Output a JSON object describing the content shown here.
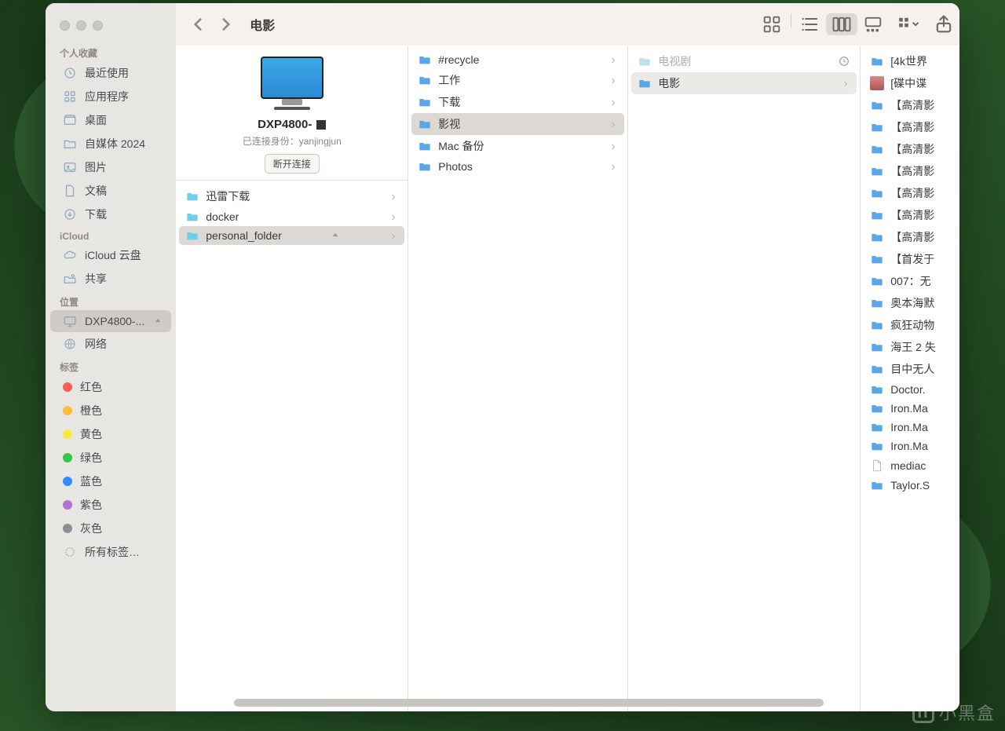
{
  "window": {
    "title": "电影"
  },
  "sidebar": {
    "sections": [
      {
        "header": "个人收藏",
        "items": [
          {
            "icon": "clock",
            "label": "最近使用"
          },
          {
            "icon": "grid",
            "label": "应用程序"
          },
          {
            "icon": "desktop",
            "label": "桌面"
          },
          {
            "icon": "folder",
            "label": "自媒体 2024"
          },
          {
            "icon": "image",
            "label": "图片"
          },
          {
            "icon": "doc",
            "label": "文稿"
          },
          {
            "icon": "download",
            "label": "下载"
          }
        ]
      },
      {
        "header": "iCloud",
        "items": [
          {
            "icon": "cloud",
            "label": "iCloud 云盘"
          },
          {
            "icon": "share",
            "label": "共享"
          }
        ]
      },
      {
        "header": "位置",
        "items": [
          {
            "icon": "display",
            "label": "DXP4800-...",
            "selected": true,
            "eject": true
          },
          {
            "icon": "globe",
            "label": "网络"
          }
        ]
      },
      {
        "header": "标签",
        "items": [
          {
            "tag": "#fc5b57",
            "label": "红色"
          },
          {
            "tag": "#fdbc40",
            "label": "橙色"
          },
          {
            "tag": "#fce83a",
            "label": "黄色"
          },
          {
            "tag": "#33c748",
            "label": "绿色"
          },
          {
            "tag": "#2e8cff",
            "label": "蓝色"
          },
          {
            "tag": "#b072da",
            "label": "紫色"
          },
          {
            "tag": "#8e8e93",
            "label": "灰色"
          },
          {
            "icon": "alltags",
            "label": "所有标签…"
          }
        ]
      }
    ]
  },
  "device": {
    "name": "DXP4800-",
    "status_prefix": "已连接身份：",
    "user": "yanjingjun",
    "disconnect": "断开连接"
  },
  "columns": [
    {
      "items": [
        {
          "label": "迅雷下载",
          "folder": "cyan",
          "chev": true
        },
        {
          "label": "docker",
          "folder": "cyan",
          "chev": true
        },
        {
          "label": "personal_folder",
          "folder": "cyan",
          "selected": true,
          "eject": true,
          "chev": true
        }
      ]
    },
    {
      "items": [
        {
          "label": "#recycle",
          "folder": "blue",
          "chev": true
        },
        {
          "label": "工作",
          "folder": "blue",
          "chev": true
        },
        {
          "label": "下载",
          "folder": "blue",
          "chev": true
        },
        {
          "label": "影视",
          "folder": "blue",
          "selected": true,
          "chev": true
        },
        {
          "label": "Mac 备份",
          "folder": "blue",
          "chev": true
        },
        {
          "label": "Photos",
          "folder": "blue",
          "chev": true
        }
      ]
    },
    {
      "items": [
        {
          "label": "电视剧",
          "folder": "light",
          "dim": true,
          "chev": false,
          "time": true
        },
        {
          "label": "电影",
          "folder": "blue",
          "selected": "light",
          "chev": true
        }
      ]
    },
    {
      "items": [
        {
          "label": "[4k世界",
          "folder": "blue"
        },
        {
          "label": "[碟中谍",
          "file": "img"
        },
        {
          "label": "【高清影",
          "folder": "blue"
        },
        {
          "label": "【高清影",
          "folder": "blue"
        },
        {
          "label": "【高清影",
          "folder": "blue"
        },
        {
          "label": "【高清影",
          "folder": "blue"
        },
        {
          "label": "【高清影",
          "folder": "blue"
        },
        {
          "label": "【高清影",
          "folder": "blue"
        },
        {
          "label": "【高清影",
          "folder": "blue"
        },
        {
          "label": "【首发于",
          "folder": "blue"
        },
        {
          "label": "007：无",
          "folder": "blue"
        },
        {
          "label": "奥本海默",
          "folder": "blue"
        },
        {
          "label": "疯狂动物",
          "folder": "blue"
        },
        {
          "label": "海王 2 失",
          "folder": "blue"
        },
        {
          "label": "目中无人",
          "folder": "blue"
        },
        {
          "label": "Doctor.",
          "folder": "blue"
        },
        {
          "label": "Iron.Ma",
          "folder": "blue"
        },
        {
          "label": "Iron.Ma",
          "folder": "blue"
        },
        {
          "label": "Iron.Ma",
          "folder": "blue"
        },
        {
          "label": "mediac",
          "file": "doc"
        },
        {
          "label": "Taylor.S",
          "folder": "blue"
        }
      ]
    }
  ],
  "watermark": "小黑盒"
}
